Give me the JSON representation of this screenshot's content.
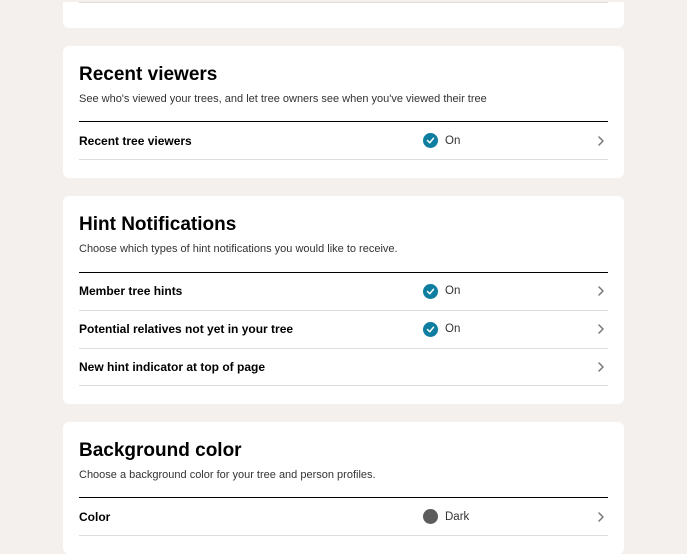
{
  "recentViewers": {
    "title": "Recent viewers",
    "desc": "See who's viewed your trees, and let tree owners see when you've viewed their tree",
    "rows": {
      "recentTreeViewers": {
        "label": "Recent tree viewers",
        "value": "On"
      }
    }
  },
  "hintNotifications": {
    "title": "Hint Notifications",
    "desc": "Choose which types of hint notifications you would like to receive.",
    "rows": {
      "memberTreeHints": {
        "label": "Member tree hints",
        "value": "On"
      },
      "potentialRelatives": {
        "label": "Potential relatives not yet in your tree",
        "value": "On"
      },
      "newHintIndicator": {
        "label": "New hint indicator at top of page"
      }
    }
  },
  "backgroundColor": {
    "title": "Background color",
    "desc": "Choose a background color for your tree and person profiles.",
    "rows": {
      "color": {
        "label": "Color",
        "value": "Dark"
      }
    }
  }
}
